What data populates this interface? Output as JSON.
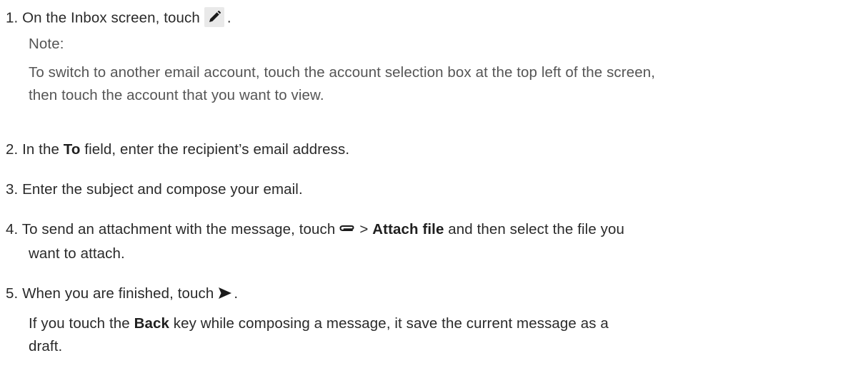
{
  "steps": {
    "s1": {
      "num": "1.",
      "pre": " On the Inbox screen, touch",
      "post": ".",
      "icon": "pencil-icon"
    },
    "note": {
      "label": "Note:",
      "line1": "To switch to another email account, touch the account selection box at the top left of the screen,",
      "line2": "then touch the account that you want to view."
    },
    "s2": {
      "num": "2.",
      "pre": " In the ",
      "bold": "To",
      "post": " field, enter the recipient’s email address."
    },
    "s3": {
      "num": "3.",
      "text": " Enter the subject and compose your email."
    },
    "s4": {
      "num": "4.",
      "pre": " To send an attachment with the message, touch",
      "gt": "> ",
      "bold": "Attach file",
      "post": " and then select the file you",
      "line2": "want to attach.",
      "icon": "paperclip-icon"
    },
    "s5": {
      "num": "5.",
      "pre": " When you are finished, touch",
      "post": ".",
      "icon": "send-icon",
      "extra_pre": "If you touch the ",
      "extra_bold": "Back",
      "extra_post": " key while composing a message, it save the current message as a",
      "extra_line2": "draft."
    }
  },
  "colors": {
    "text": "#2a2a2a",
    "note_text": "#555555",
    "icon_bg": "#e9e9e9",
    "icon": "#1a1a1a"
  }
}
